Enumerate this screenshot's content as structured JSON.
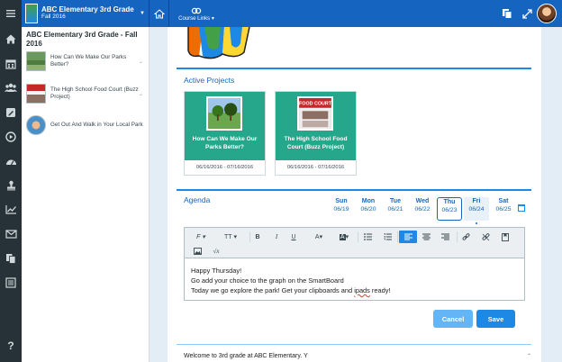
{
  "topbar": {
    "class_title": "ABC Elementary 3rd Grade",
    "class_term": "Fall 2016",
    "course_links_label": "Course Links"
  },
  "sidebar": {
    "title": "ABC Elementary 3rd Grade - Fall 2016",
    "items": [
      {
        "label": "How Can We Make Our Parks Better?"
      },
      {
        "label": "The High School Food Court (Buzz Project)"
      },
      {
        "label": "Get Out And Walk in Your Local Park"
      }
    ]
  },
  "active_projects": {
    "heading": "Active Projects",
    "cards": [
      {
        "title": "How Can We Make Our Parks Better?",
        "dates": "06/16/2016 - 07/16/2016",
        "image_caption": ""
      },
      {
        "title": "The High School Food Court (Buzz Project)",
        "dates": "06/16/2016 - 07/16/2016",
        "image_caption": "FOOD COURT"
      }
    ]
  },
  "agenda": {
    "heading": "Agenda",
    "days": [
      {
        "name": "Sun",
        "date": "06/19"
      },
      {
        "name": "Mon",
        "date": "06/20"
      },
      {
        "name": "Tue",
        "date": "06/21"
      },
      {
        "name": "Wed",
        "date": "06/22"
      },
      {
        "name": "Thu",
        "date": "06/23"
      },
      {
        "name": "Fri",
        "date": "06/24"
      },
      {
        "name": "Sat",
        "date": "06/25"
      }
    ],
    "selected_day": "Thu",
    "toolbar": {
      "font_label": "F",
      "size_label": "TT"
    },
    "content_lines": [
      "Happy Thursday!",
      "Go add your choice to the graph on the SmartBoard",
      "Today we go explore the park! Get your clipboards and ",
      "ipads",
      " ready!"
    ],
    "cancel_label": "Cancel",
    "save_label": "Save"
  },
  "welcome_text": "Welcome to 3rd grade at ABC Elementary. Y",
  "colors": {
    "topbar": "#1565c0",
    "rail": "#263238",
    "accent": "#1e88e5",
    "card": "#26a68a"
  }
}
